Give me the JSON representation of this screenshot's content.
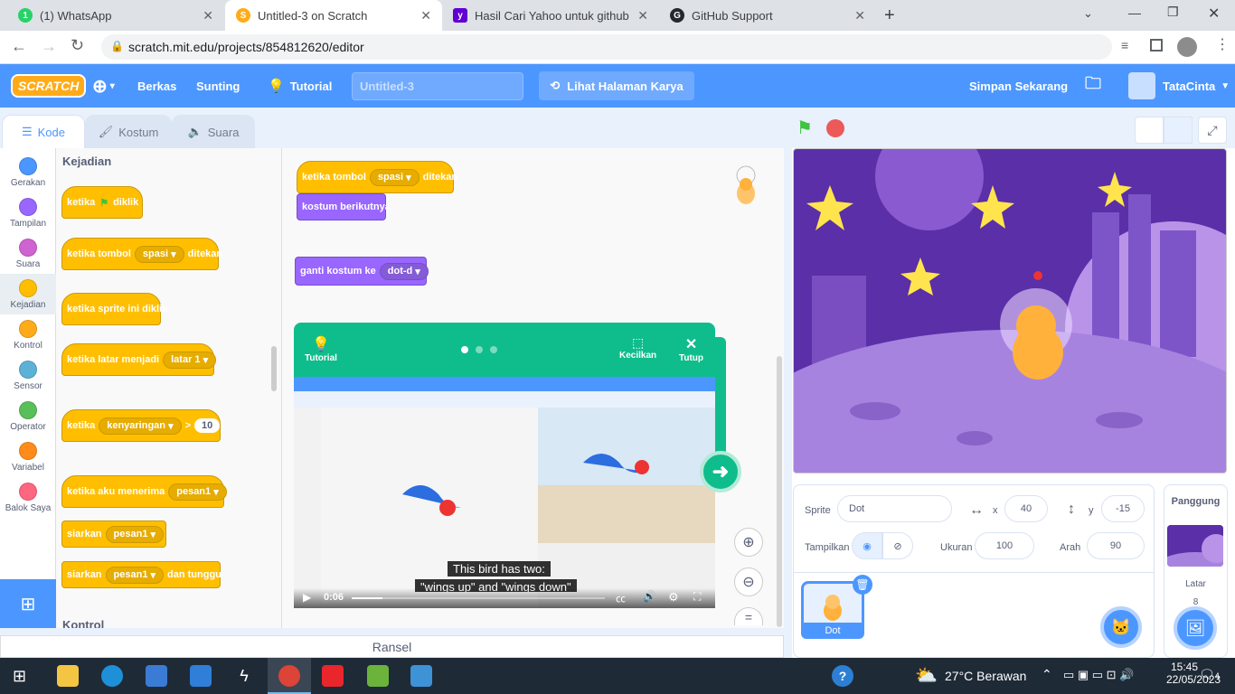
{
  "browser": {
    "tabs": [
      {
        "title": "(1) WhatsApp",
        "color": "#25d366",
        "glyph": "1"
      },
      {
        "title": "Untitled-3 on Scratch",
        "color": "#ffab19",
        "glyph": "S"
      },
      {
        "title": "Hasil Cari Yahoo untuk github log",
        "color": "#6001d2",
        "glyph": "y"
      },
      {
        "title": "GitHub Support",
        "color": "#24292f",
        "glyph": "G"
      }
    ],
    "url": "scratch.mit.edu/projects/854812620/editor"
  },
  "menu": {
    "logo": "SCRATCH",
    "file": "Berkas",
    "edit": "Sunting",
    "tutorial": "Tutorial",
    "project_title": "Untitled-3",
    "see_project": "Lihat Halaman Karya",
    "save": "Simpan Sekarang",
    "user": "TataCinta"
  },
  "editor_tabs": {
    "code": "Kode",
    "costume": "Kostum",
    "sound": "Suara"
  },
  "categories": [
    {
      "label": "Gerakan",
      "color": "#4c97ff"
    },
    {
      "label": "Tampilan",
      "color": "#9966ff"
    },
    {
      "label": "Suara",
      "color": "#cf63cf"
    },
    {
      "label": "Kejadian",
      "color": "#ffbf00"
    },
    {
      "label": "Kontrol",
      "color": "#ffab19"
    },
    {
      "label": "Sensor",
      "color": "#5cb1d6"
    },
    {
      "label": "Operator",
      "color": "#59c059"
    },
    {
      "label": "Variabel",
      "color": "#ff8c1a"
    },
    {
      "label": "Balok Saya",
      "color": "#ff6680"
    }
  ],
  "palette": {
    "heading": "Kejadian",
    "next_heading": "Kontrol",
    "b1": {
      "a": "ketika",
      "b": "diklik"
    },
    "b2": {
      "a": "ketika tombol",
      "drop": "spasi",
      "b": "ditekan"
    },
    "b3": {
      "a": "ketika sprite ini diklik"
    },
    "b4": {
      "a": "ketika latar menjadi",
      "drop": "latar 1"
    },
    "b5": {
      "a": "ketika",
      "drop": "kenyaringan",
      "op": ">",
      "num": "10"
    },
    "b6": {
      "a": "ketika aku menerima",
      "drop": "pesan1"
    },
    "b7": {
      "a": "siarkan",
      "drop": "pesan1"
    },
    "b8": {
      "a": "siarkan",
      "drop": "pesan1",
      "b": "dan tunggu"
    }
  },
  "workspace": {
    "w1": {
      "a": "ketika tombol",
      "drop": "spasi",
      "b": "ditekan"
    },
    "w2": {
      "a": "kostum berikutnya"
    },
    "w3": {
      "a": "ganti kostum ke",
      "drop": "dot-d"
    }
  },
  "tutorial": {
    "label": "Tutorial",
    "shrink": "Kecilkan",
    "close": "Tutup",
    "caption1": "This bird has two:",
    "caption2": "\"wings up\" and \"wings down\"",
    "time": "0:06",
    "progress": 0.12
  },
  "ransel": "Ransel",
  "sprite_info": {
    "sprite_label": "Sprite",
    "sprite_name": "Dot",
    "x_label": "x",
    "x": "40",
    "y_label": "y",
    "y": "-15",
    "show_label": "Tampilkan",
    "size_label": "Ukuran",
    "size": "100",
    "dir_label": "Arah",
    "dir": "90",
    "thumb_name": "Dot"
  },
  "stage_pane": {
    "title": "Panggung",
    "backdrops_label": "Latar",
    "backdrops_count": "8"
  },
  "taskbar": {
    "weather": "27°C Berawan",
    "time": "15:45",
    "date": "22/05/2023",
    "notif": "4"
  }
}
